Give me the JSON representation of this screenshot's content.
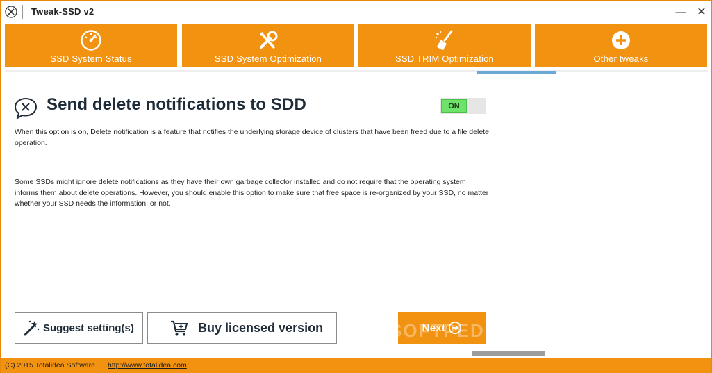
{
  "window": {
    "title": "Tweak-SSD v2",
    "minimize_glyph": "—",
    "close_glyph": "✕"
  },
  "tabs": [
    {
      "label": "SSD System Status",
      "icon": "speedometer-icon"
    },
    {
      "label": "SSD System Optimization",
      "icon": "tools-icon"
    },
    {
      "label": "SSD TRIM Optimization",
      "icon": "broom-icon"
    },
    {
      "label": "Other tweaks",
      "icon": "plus-circle-icon"
    }
  ],
  "content": {
    "heading": "Send delete notifications to SDD",
    "toggle_label": "ON",
    "paragraph1": "When this option is on, Delete notification is a feature that notifies the underlying storage device of clusters that have been freed due to a file delete operation.",
    "paragraph2": "Some SSDs might ignore delete notifications as they have their own garbage collector installed and do not require that the operating system informs them about delete operations. However, you should enable this option to make sure that free space is re-organized by your SSD, no matter whether your SSD needs the information, or not."
  },
  "buttons": {
    "suggest_label": "Suggest setting(s)",
    "buy_label": "Buy licensed version",
    "next_label": "Next"
  },
  "watermark": "SOFTPEDIA",
  "status": {
    "copyright": "(C) 2015 Totalidea Software",
    "link": "http://www.totalidea.com"
  },
  "colors": {
    "accent": "#f29211",
    "toggle_on": "#6ee36a",
    "tab_indicator": "#6aa8d6"
  }
}
